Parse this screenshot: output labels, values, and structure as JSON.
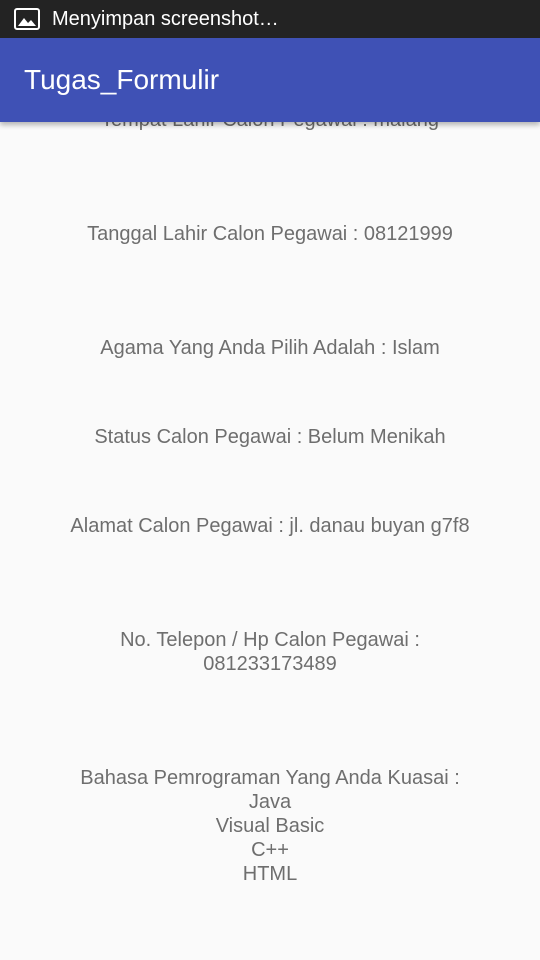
{
  "status_bar": {
    "icon": "image-icon",
    "notification_text": "Menyimpan screenshot…"
  },
  "app_bar": {
    "title": "Tugas_Formulir",
    "color": "#3f51b5"
  },
  "fields": {
    "tempat_lahir": "Tempat Lahir Calon Pegawai : malang",
    "tanggal_lahir": "Tanggal Lahir Calon Pegawai : 08121999",
    "agama": "Agama Yang Anda Pilih Adalah : Islam",
    "status": "Status Calon Pegawai : Belum Menikah",
    "alamat": "Alamat Calon Pegawai : jl. danau buyan g7f8",
    "telepon_label": "No. Telepon / Hp Calon Pegawai :",
    "telepon_value": "081233173489",
    "bahasa_label": "Bahasa Pemrograman Yang Anda Kuasai :",
    "bahasa_items": [
      "Java",
      "Visual Basic",
      "C++",
      "HTML"
    ]
  }
}
